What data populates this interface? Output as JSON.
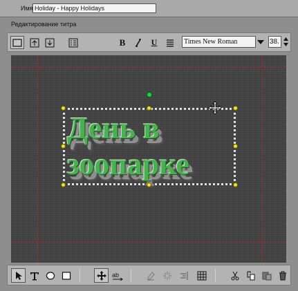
{
  "header": {
    "name_label": "Имя:",
    "name_value": "Holiday - Happy Holidays"
  },
  "panel": {
    "title": "Редактирование титра"
  },
  "toolbar": {
    "font_name": "Times New Roman",
    "font_size": "38.",
    "bold_label": "B",
    "italic_label": "I",
    "underline_label": "U"
  },
  "canvas": {
    "title_line1": "День в",
    "title_line2": "зоопарке",
    "text_color": "#46b34f",
    "background_color": "#434343",
    "guide_color": "#b3242a"
  },
  "icons": {
    "top_left": [
      "frame-icon",
      "align-top-icon",
      "align-bottom-icon",
      "list-icon"
    ],
    "format": [
      "bold-icon",
      "italic-icon",
      "underline-icon",
      "justify-icon"
    ],
    "bottom": [
      "arrow-select-icon",
      "text-tool-icon",
      "ellipse-tool-icon",
      "rectangle-tool-icon",
      "move-tool-icon",
      "kerning-icon",
      "erase-icon",
      "sparkle-icon",
      "align-right-icon",
      "grid-icon",
      "cut-icon",
      "copy-icon",
      "paste-icon",
      "trash-icon"
    ]
  }
}
